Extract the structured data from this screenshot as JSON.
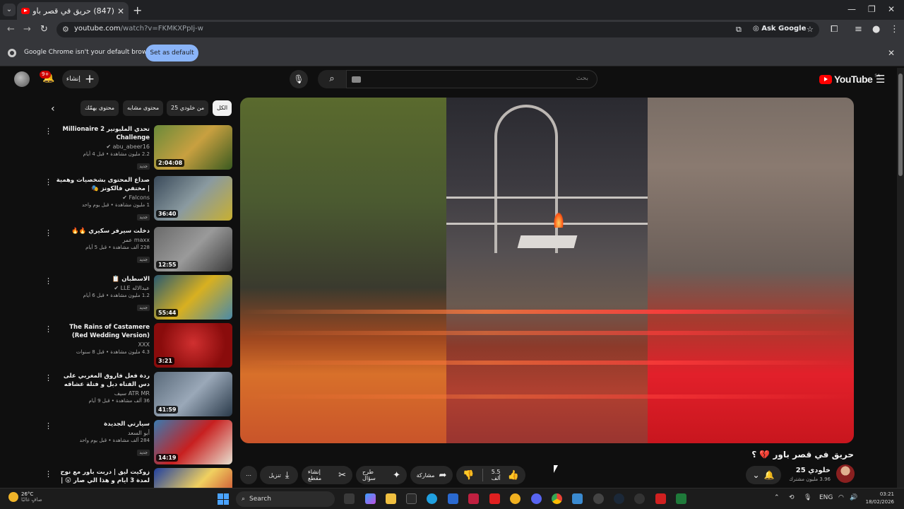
{
  "browser": {
    "tab_title": "(847) حريق في قصر باور 💔 ؟",
    "url_host": "youtube.com",
    "url_path": "/watch?v=FKMKXPpIj-w",
    "ask_google": "Ask Google",
    "infobar_message": "Google Chrome isn't your default browser",
    "infobar_button": "Set as default"
  },
  "header": {
    "create_label": "إنشاء",
    "notification_badge": "9+",
    "search_placeholder": "بحث",
    "logo_text": "YouTube",
    "logo_region": "SA"
  },
  "chips": [
    {
      "label": "الكل",
      "active": true
    },
    {
      "label": "من خلودي 25"
    },
    {
      "label": "محتوى مشابه"
    },
    {
      "label": "محتوى يهمّك"
    }
  ],
  "recommendations": [
    {
      "title": "تحدي المليونير 2 Millionaire Challenge",
      "channel": "abu_abeer16 ✔",
      "stats": "2.2 مليون مشاهدة • قبل 4 أيام",
      "badge": "جديد",
      "duration": "2:04:08"
    },
    {
      "title": "صداع المحتوى بشخصيات وهمية | مختفي فالكونز 🎭",
      "channel": "Falcons ✔",
      "stats": "1 مليون مشاهدة • قبل يوم واحد",
      "badge": "جديد",
      "duration": "36:40"
    },
    {
      "title": "دخلت سيرفر سكيري 🔥🔥",
      "channel": "maxx عمر",
      "stats": "228 ألف مشاهدة • قبل 5 أيام",
      "badge": "جديد",
      "duration": "12:55"
    },
    {
      "title": "الاسطبان 📋",
      "channel": "عبدالاله LLE ✔",
      "stats": "1.2 مليون مشاهدة • قبل 6 أيام",
      "badge": "جديد",
      "duration": "55:44"
    },
    {
      "title": "The Rains of Castamere (Red Wedding Version)",
      "channel": "XXX",
      "stats": "4.3 مليون مشاهدة • قبل 8 سنوات",
      "badge": "",
      "duration": "3:21"
    },
    {
      "title": "ردة فعل فاروق المغربي على دس الفتاه دبل و فتلة عشاقه 🔥 |فاروق يختار الفائز بين عبا...",
      "channel": "ATR MR سيف",
      "stats": "36 ألف مشاهدة • قبل 9 أيام",
      "badge": "",
      "duration": "41:59"
    },
    {
      "title": "سيارتي الجديدة",
      "channel": "أبو السعد",
      "stats": "284 ألف مشاهدة • قبل يوم واحد",
      "badge": "جديد",
      "duration": "14:19"
    },
    {
      "title": "زوكيت ليق | دربت باور مع نوح لمدة 3 ايام و هذا الي صار 😮 | Rocket League",
      "channel": "",
      "stats": "",
      "badge": "",
      "duration": ""
    }
  ],
  "video": {
    "title": "حريق في قصر باور 💔 ؟",
    "channel": "خلودي 25",
    "subscribers": "3.96 مليون مشترك",
    "likes": "5.5 ألف",
    "share_label": "مشاركة",
    "ask_label": "طرح سؤال",
    "clip_label": "إنشاء مقطع",
    "download_label": "تنزيل"
  },
  "taskbar": {
    "temp": "26°C",
    "weather": "صافٍ غالبًا",
    "search": "Search",
    "lang": "ENG",
    "time": "03:21",
    "date": "18/02/2026"
  }
}
